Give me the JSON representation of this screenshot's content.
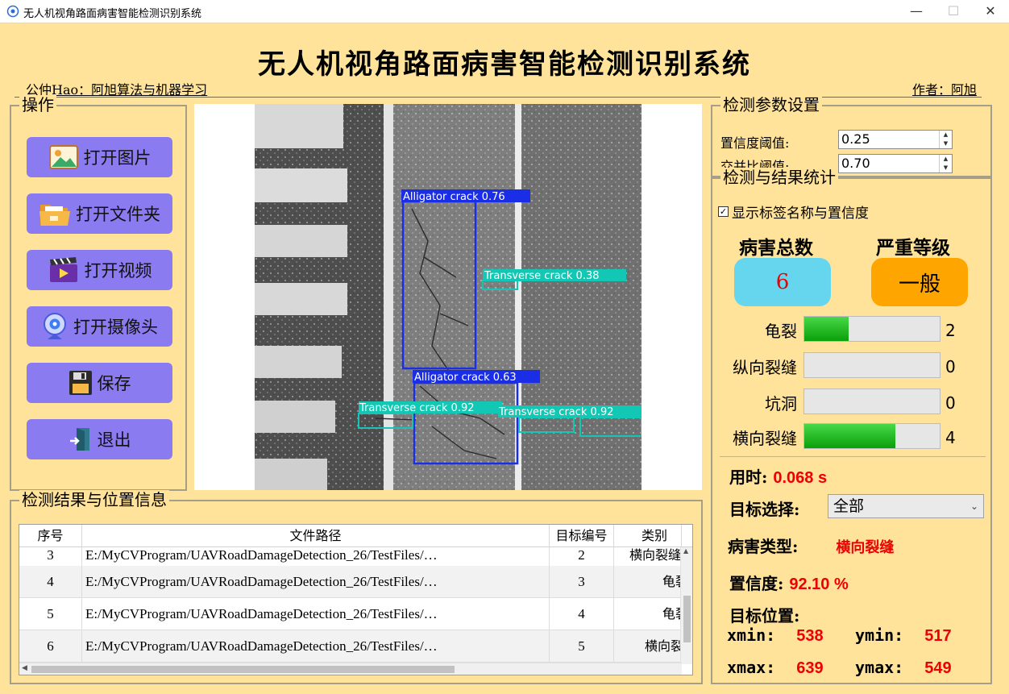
{
  "window": {
    "title": "无人机视角路面病害智能检测识别系统"
  },
  "header": {
    "title": "无人机视角路面病害智能检测识别系统",
    "left_note": "公仲Hao：阿旭算法与机器学习",
    "right_note": "作者：阿旭"
  },
  "ops": {
    "label": "操作",
    "open_image": "打开图片",
    "open_folder": "打开文件夹",
    "open_video": "打开视频",
    "open_camera": "打开摄像头",
    "save": "保存",
    "exit": "退出"
  },
  "detections": [
    {
      "label": "Alligator crack 0.76",
      "color": "#1a2ee8"
    },
    {
      "label": "Transverse crack 0.38",
      "color": "#12c8b4"
    },
    {
      "label": "Alligator crack 0.63",
      "color": "#1a2ee8"
    },
    {
      "label": "Transverse crack 0.92",
      "color": "#12c8b4"
    },
    {
      "label": "Transverse crack 0.92",
      "color": "#12c8b4"
    }
  ],
  "params": {
    "label": "检测参数设置",
    "conf_label": "置信度阈值:",
    "conf_value": "0.25",
    "iou_label": "交并比阈值:",
    "iou_value": "0.70"
  },
  "stats": {
    "label": "检测与结果统计",
    "show_labels": "显示标签名称与置信度",
    "total_label": "病害总数",
    "total_value": "6",
    "severity_label": "严重等级",
    "severity_value": "一般",
    "classes": [
      {
        "name": "龟裂",
        "count": "2",
        "fraction": 0.33
      },
      {
        "name": "纵向裂缝",
        "count": "0",
        "fraction": 0
      },
      {
        "name": "坑洞",
        "count": "0",
        "fraction": 0
      },
      {
        "name": "横向裂缝",
        "count": "4",
        "fraction": 0.67
      }
    ],
    "time_label": "用时:",
    "time_value": "0.068 s",
    "target_select_label": "目标选择:",
    "target_select_value": "全部",
    "type_label": "病害类型:",
    "type_value": "横向裂缝",
    "conf_label": "置信度:",
    "conf_value": "92.10 %",
    "pos_label": "目标位置:",
    "xmin_label": "xmin:",
    "xmin_value": "538",
    "ymin_label": "ymin:",
    "ymin_value": "517",
    "xmax_label": "xmax:",
    "xmax_value": "639",
    "ymax_label": "ymax:",
    "ymax_value": "549"
  },
  "results": {
    "label": "检测结果与位置信息",
    "columns": [
      "序号",
      "文件路径",
      "目标编号",
      "类别"
    ],
    "rows": [
      {
        "idx": "3",
        "path": "E:/MyCVProgram/UAVRoadDamageDetection_26/TestFiles/…",
        "target": "2",
        "cls": "横向裂缝"
      },
      {
        "idx": "4",
        "path": "E:/MyCVProgram/UAVRoadDamageDetection_26/TestFiles/…",
        "target": "3",
        "cls": "龟裂"
      },
      {
        "idx": "5",
        "path": "E:/MyCVProgram/UAVRoadDamageDetection_26/TestFiles/…",
        "target": "4",
        "cls": "龟裂"
      },
      {
        "idx": "6",
        "path": "E:/MyCVProgram/UAVRoadDamageDetection_26/TestFiles/…",
        "target": "5",
        "cls": "横向裂缝"
      }
    ]
  },
  "colors": {
    "background": "#ffe39b",
    "button": "#8a7cf0",
    "total_pill": "#66d6ee",
    "severity_pill": "#ffa500",
    "accent_red": "#ee0000"
  }
}
